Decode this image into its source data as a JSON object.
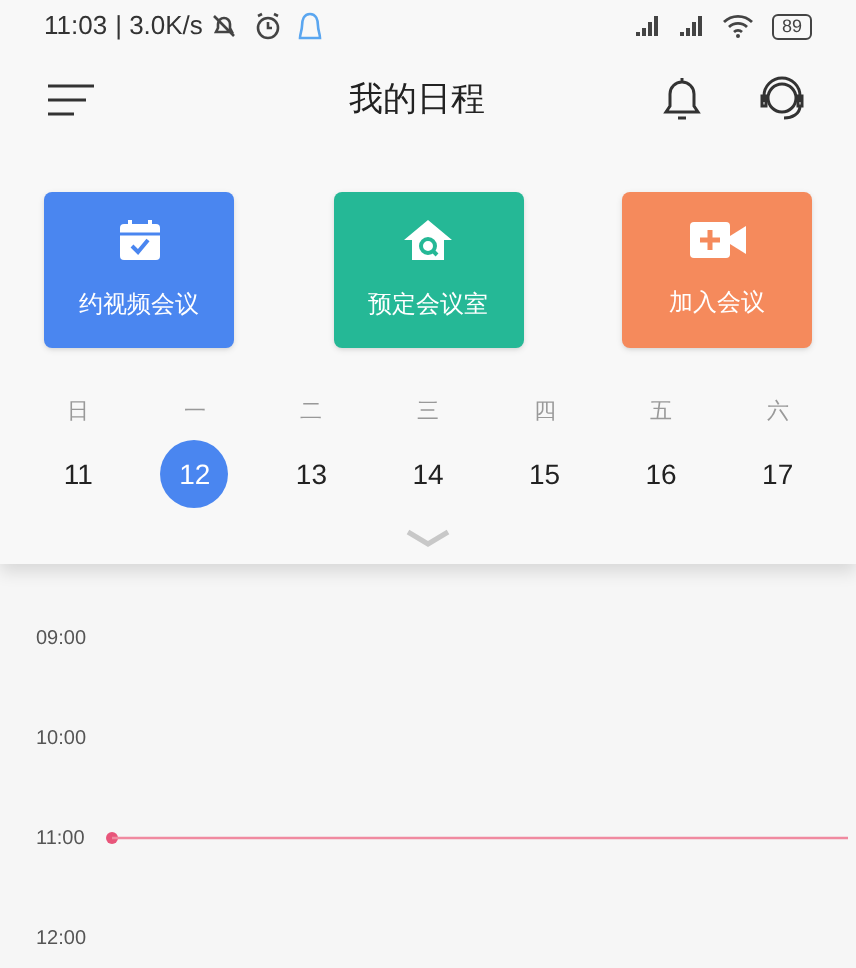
{
  "status_bar": {
    "time": "11:03",
    "speed": "| 3.0K/s",
    "battery": "89"
  },
  "header": {
    "title": "我的日程"
  },
  "actions": [
    {
      "kind": "video",
      "label": "约视频会议",
      "color": "#4a86f0"
    },
    {
      "kind": "room",
      "label": "预定会议室",
      "color": "#25b896"
    },
    {
      "kind": "join",
      "label": "加入会议",
      "color": "#f58a5c"
    }
  ],
  "week": {
    "days": [
      {
        "weekday": "日",
        "date": "11",
        "selected": false
      },
      {
        "weekday": "一",
        "date": "12",
        "selected": true
      },
      {
        "weekday": "二",
        "date": "13",
        "selected": false
      },
      {
        "weekday": "三",
        "date": "14",
        "selected": false
      },
      {
        "weekday": "四",
        "date": "15",
        "selected": false
      },
      {
        "weekday": "五",
        "date": "16",
        "selected": false
      },
      {
        "weekday": "六",
        "date": "17",
        "selected": false
      }
    ]
  },
  "timeline": [
    {
      "time": "09:00",
      "current": false
    },
    {
      "time": "10:00",
      "current": false
    },
    {
      "time": "11:00",
      "current": true
    },
    {
      "time": "12:00",
      "current": false
    }
  ]
}
